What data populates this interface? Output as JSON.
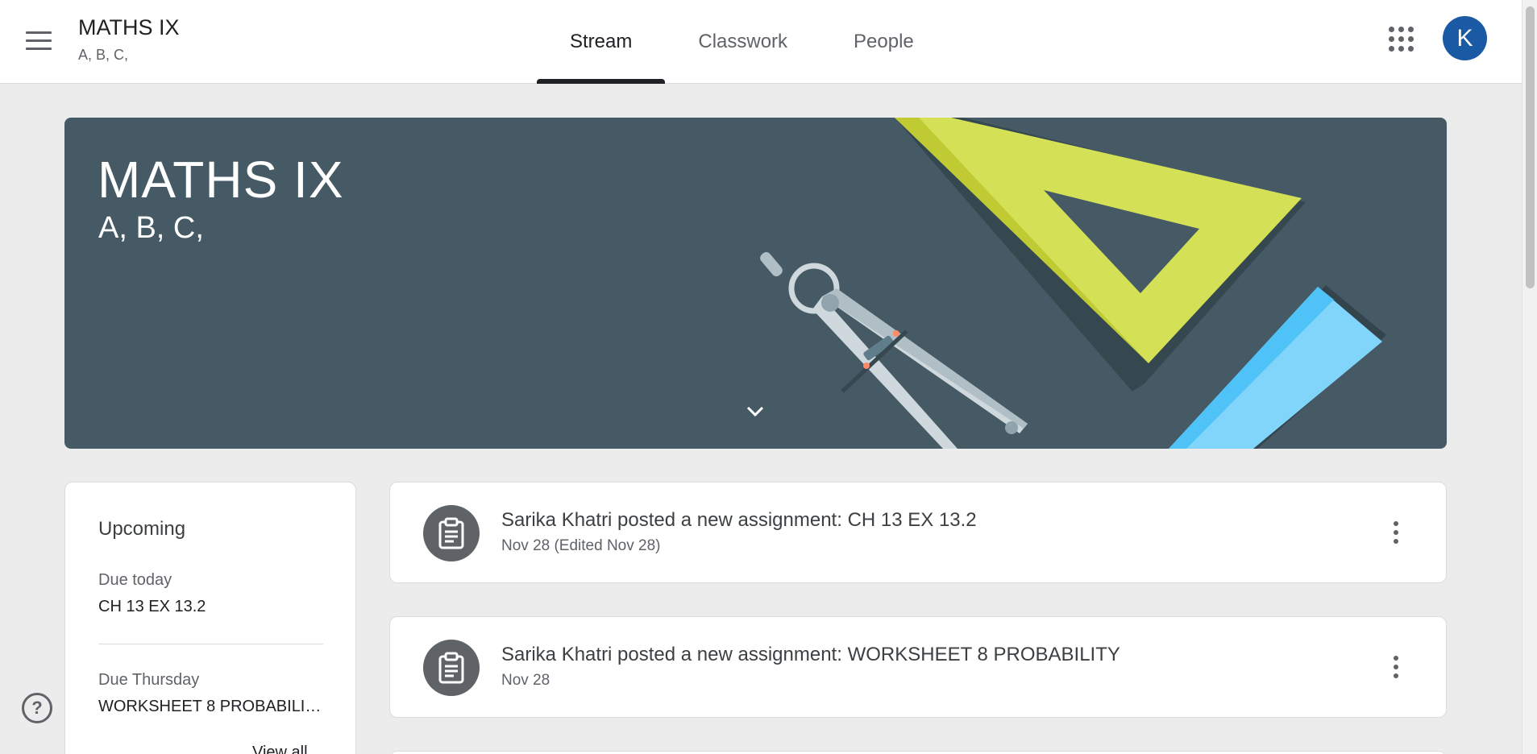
{
  "header": {
    "class_name": "MATHS IX",
    "class_sections": "A, B, C,",
    "tabs": [
      {
        "label": "Stream"
      },
      {
        "label": "Classwork"
      },
      {
        "label": "People"
      }
    ],
    "avatar_letter": "K",
    "avatar_color": "#1a5aa5"
  },
  "banner": {
    "title": "MATHS IX",
    "subtitle": "A, B, C,",
    "background_color": "#455a64"
  },
  "upcoming": {
    "title": "Upcoming",
    "groups": [
      {
        "due": "Due today",
        "item": "CH 13 EX 13.2"
      },
      {
        "due": "Due Thursday",
        "item": "WORKSHEET 8 PROBABILITY"
      }
    ],
    "view_all": "View all"
  },
  "stream": {
    "posts": [
      {
        "text": "Sarika Khatri posted a new assignment: CH 13 EX 13.2",
        "date": "Nov 28 (Edited Nov 28)",
        "icon": "assignment-icon"
      },
      {
        "text": "Sarika Khatri posted a new assignment: WORKSHEET 8 PROBABILITY",
        "date": "Nov 28",
        "icon": "assignment-icon"
      }
    ]
  },
  "help": {
    "label": "?"
  }
}
